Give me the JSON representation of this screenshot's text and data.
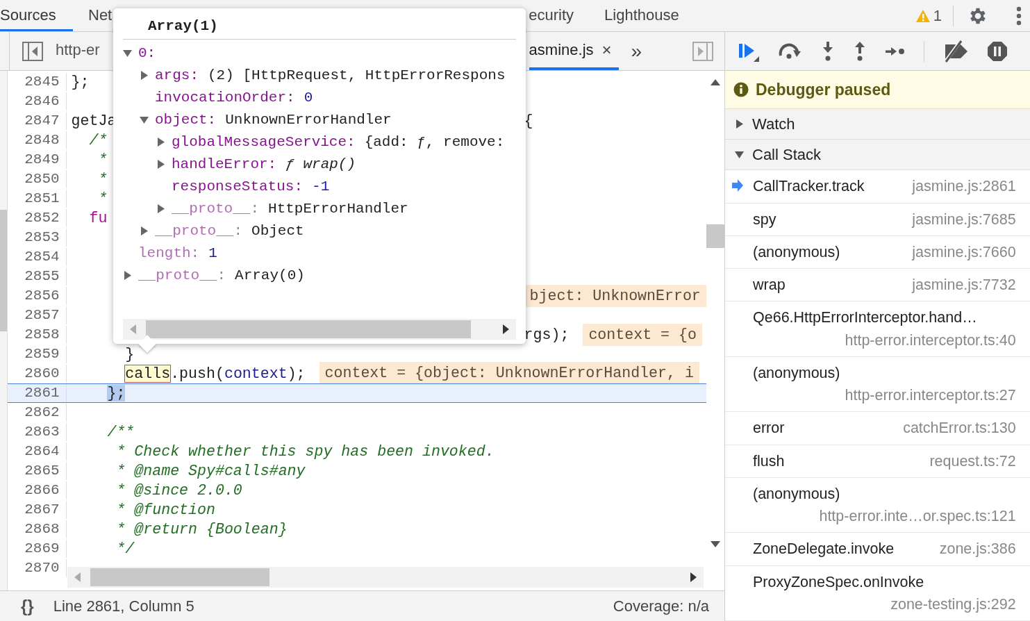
{
  "main_tabs": [
    {
      "label": "Sources",
      "selected": true
    },
    {
      "label": "Net",
      "selected": false
    },
    {
      "label": "ecurity",
      "selected": false
    },
    {
      "label": "Lighthouse",
      "selected": false
    }
  ],
  "warnings": {
    "count": "1"
  },
  "file_tabs": [
    {
      "label": "http-er",
      "selected": false,
      "closable": false
    },
    {
      "label": "asmine.js",
      "selected": true,
      "closable": true
    }
  ],
  "file_tabs_overflow": "»",
  "close_glyph": "×",
  "editor": {
    "lines": [
      {
        "number": "2845",
        "current": false,
        "code": [
          {
            "text": "};",
            "kind": "plain"
          }
        ]
      },
      {
        "number": "2846",
        "current": false
      },
      {
        "number": "2847",
        "current": false,
        "code": [
          {
            "text": "getJa",
            "kind": "plain"
          }
        ],
        "right": {
          "code": [
            {
              "text": "{",
              "kind": "plain"
            }
          ]
        }
      },
      {
        "number": "2848",
        "current": false,
        "code": [
          {
            "text": "  /*",
            "kind": "comment"
          }
        ]
      },
      {
        "number": "2849",
        "current": false,
        "code": [
          {
            "text": "   *",
            "kind": "comment"
          }
        ]
      },
      {
        "number": "2850",
        "current": false,
        "code": [
          {
            "text": "   *",
            "kind": "comment"
          }
        ]
      },
      {
        "number": "2851",
        "current": false,
        "code": [
          {
            "text": "   *",
            "kind": "comment"
          }
        ]
      },
      {
        "number": "2852",
        "current": false,
        "code": [
          {
            "text": "  fu",
            "kind": "keyword"
          }
        ]
      },
      {
        "number": "2853",
        "current": false
      },
      {
        "number": "2854",
        "current": false
      },
      {
        "number": "2855",
        "current": false
      },
      {
        "number": "2856",
        "current": false,
        "right": {
          "value": "bject: UnknownError"
        }
      },
      {
        "number": "2857",
        "current": false
      },
      {
        "number": "2858",
        "current": false,
        "right": {
          "code": [
            {
              "text": "rgs);",
              "kind": "plain"
            }
          ],
          "value": "context = {o"
        }
      },
      {
        "number": "2859",
        "current": false,
        "code": [
          {
            "text": "      }",
            "kind": "plain"
          }
        ]
      },
      {
        "number": "2860",
        "current": false,
        "code": [
          {
            "text": "      calls",
            "kind": "highlight"
          },
          {
            "text": ".push(",
            "kind": "plain"
          },
          {
            "text": "context",
            "kind": "variable"
          },
          {
            "text": ");",
            "kind": "plain"
          }
        ],
        "value": "context = {object: UnknownErrorHandler, i"
      },
      {
        "number": "2861",
        "current": true,
        "code": [
          {
            "text": "    };",
            "kind": "selection"
          }
        ]
      },
      {
        "number": "2862",
        "current": false
      },
      {
        "number": "2863",
        "current": false,
        "code": [
          {
            "text": "    /**",
            "kind": "comment"
          }
        ]
      },
      {
        "number": "2864",
        "current": false,
        "code": [
          {
            "text": "     * Check whether this spy has been invoked.",
            "kind": "comment"
          }
        ]
      },
      {
        "number": "2865",
        "current": false,
        "code": [
          {
            "text": "     * @name Spy#calls#any",
            "kind": "comment"
          }
        ]
      },
      {
        "number": "2866",
        "current": false,
        "code": [
          {
            "text": "     * @since 2.0.0",
            "kind": "comment"
          }
        ]
      },
      {
        "number": "2867",
        "current": false,
        "code": [
          {
            "text": "     * @function",
            "kind": "comment"
          }
        ]
      },
      {
        "number": "2868",
        "current": false,
        "code": [
          {
            "text": "     * @return {Boolean}",
            "kind": "comment"
          }
        ]
      },
      {
        "number": "2869",
        "current": false,
        "code": [
          {
            "text": "     */",
            "kind": "comment"
          }
        ]
      },
      {
        "number": "2870",
        "current": false
      }
    ]
  },
  "popover": {
    "title": "Array(1)",
    "tree": [
      {
        "key": "0:",
        "dimmed": false,
        "expanded": true,
        "children": [
          {
            "key": "args:",
            "value": "(2) [HttpRequest, HttpErrorRespons",
            "kind": "object",
            "dimmed": false,
            "expanded": false
          },
          {
            "key": "invocationOrder:",
            "value": "0",
            "kind": "number",
            "dimmed": false
          },
          {
            "key": "object:",
            "value": "UnknownErrorHandler",
            "kind": "object",
            "dimmed": false,
            "expanded": true,
            "children": [
              {
                "key": "globalMessageService:",
                "value": "{add: ƒ, remove:",
                "kind": "object",
                "dimmed": false,
                "expanded": false
              },
              {
                "key": "handleError:",
                "value": "ƒ wrap()",
                "kind": "function",
                "dimmed": false,
                "expanded": false
              },
              {
                "key": "responseStatus:",
                "value": "-1",
                "kind": "number",
                "dimmed": false
              },
              {
                "key": "__proto__:",
                "value": "HttpErrorHandler",
                "kind": "object",
                "dimmed": true,
                "expanded": false
              }
            ]
          },
          {
            "key": "__proto__:",
            "value": "Object",
            "kind": "object",
            "dimmed": true,
            "expanded": false
          }
        ]
      },
      {
        "key": "length:",
        "value": "1",
        "kind": "number",
        "dimmed": true
      },
      {
        "key": "__proto__:",
        "value": "Array(0)",
        "kind": "object",
        "dimmed": true,
        "expanded": false
      }
    ]
  },
  "banner": "Debugger paused",
  "sections": [
    {
      "title": "Watch",
      "expanded": false
    },
    {
      "title": "Call Stack",
      "expanded": true
    }
  ],
  "call_stack": [
    {
      "name": "CallTracker.track",
      "location": "jasmine.js:2861",
      "selected": true
    },
    {
      "name": "spy",
      "location": "jasmine.js:7685",
      "selected": false
    },
    {
      "name": "(anonymous)",
      "location": "jasmine.js:7660",
      "selected": false
    },
    {
      "name": "wrap",
      "location": "jasmine.js:7732",
      "selected": false
    },
    {
      "name": "Qe66.HttpErrorInterceptor.hand…",
      "location": "http-error.interceptor.ts:40",
      "selected": false
    },
    {
      "name": "(anonymous)",
      "location": "http-error.interceptor.ts:27",
      "selected": false
    },
    {
      "name": "error",
      "location": "catchError.ts:130",
      "selected": false
    },
    {
      "name": "flush",
      "location": "request.ts:72",
      "selected": false
    },
    {
      "name": "(anonymous)",
      "location": "http-error.inte…or.spec.ts:121",
      "selected": false
    },
    {
      "name": "ZoneDelegate.invoke",
      "location": "zone.js:386",
      "selected": false
    },
    {
      "name": "ProxyZoneSpec.onInvoke",
      "location": "zone-testing.js:292",
      "selected": false
    }
  ],
  "status_bar": {
    "format_button": "{}",
    "position": "Line 2861, Column 5",
    "coverage": "Coverage: n/a"
  }
}
